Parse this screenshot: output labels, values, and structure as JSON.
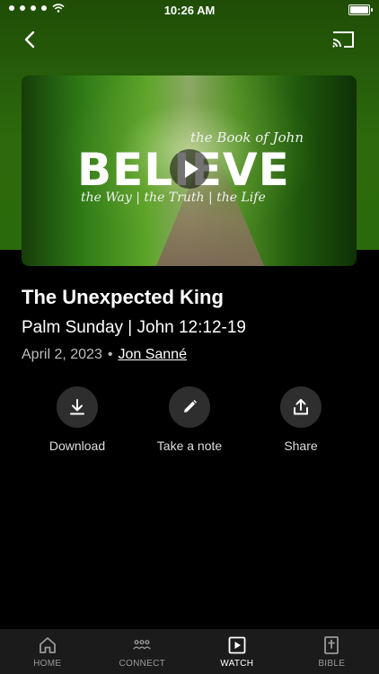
{
  "status_bar": {
    "time": "10:26 AM"
  },
  "video": {
    "script_top": "the Book of John",
    "title": "BELIEVE",
    "script_bottom": "the Way | the Truth | the Life"
  },
  "sermon": {
    "title": "The Unexpected King",
    "subtitle": "Palm Sunday | John 12:12-19",
    "date": "April 2, 2023",
    "separator": "•",
    "speaker": "Jon Sanné"
  },
  "actions": [
    {
      "label": "Download",
      "icon": "download-icon"
    },
    {
      "label": "Take a note",
      "icon": "pencil-icon"
    },
    {
      "label": "Share",
      "icon": "share-icon"
    }
  ],
  "tabs": [
    {
      "label": "HOME",
      "icon": "home-icon",
      "active": false
    },
    {
      "label": "CONNECT",
      "icon": "people-icon",
      "active": false
    },
    {
      "label": "WATCH",
      "icon": "play-icon",
      "active": true
    },
    {
      "label": "BIBLE",
      "icon": "bible-icon",
      "active": false
    }
  ],
  "colors": {
    "header_green": "#2c6a0d",
    "background": "#000000",
    "tab_bar": "#1b1b1b"
  }
}
